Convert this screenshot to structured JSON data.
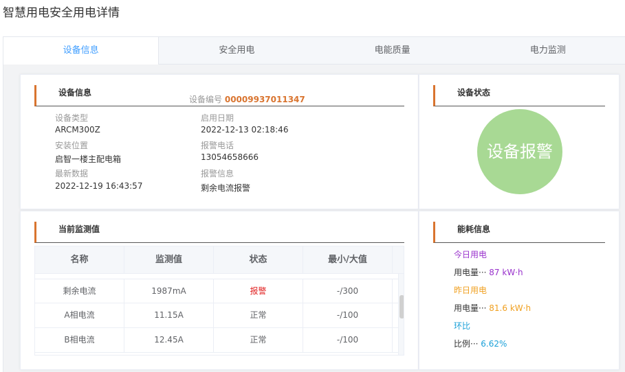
{
  "page_title": "智慧用电安全用电详情",
  "tabs": [
    {
      "label": "设备信息",
      "active": true
    },
    {
      "label": "安全用电",
      "active": false
    },
    {
      "label": "电能质量",
      "active": false
    },
    {
      "label": "电力监测",
      "active": false
    }
  ],
  "device_info": {
    "title": "设备信息",
    "device_no_label": "设备编号",
    "device_no": "00009937011347",
    "fields": {
      "type_label": "设备类型",
      "type_value": "ARCM300Z",
      "location_label": "安装位置",
      "location_value": "启智一楼主配电箱",
      "latest_label": "最新数据",
      "latest_value": "2022-12-19 16:43:57",
      "enable_label": "启用日期",
      "enable_value": "2022-12-13 02:18:46",
      "phone_label": "报警电话",
      "phone_value": "13054658666",
      "alarm_label": "报警信息",
      "alarm_value": "剩余电流报警"
    }
  },
  "device_status": {
    "title": "设备状态",
    "status": "设备报警",
    "color": "#a8d994"
  },
  "monitor": {
    "title": "当前监测值",
    "columns": [
      "名称",
      "监测值",
      "状态",
      "最小/大值"
    ],
    "rows": [
      {
        "name": "剩余电流",
        "value": "1987mA",
        "status": "报警",
        "range": "-/300"
      },
      {
        "name": "A相电流",
        "value": "11.15A",
        "status": "正常",
        "range": "-/100"
      },
      {
        "name": "B相电流",
        "value": "12.45A",
        "status": "正常",
        "range": "-/100"
      }
    ],
    "alarm_color": "#e02020"
  },
  "energy": {
    "title": "能耗信息",
    "today_label": "今日用电",
    "today_text": "用电量···",
    "today_value": "87 kW·h",
    "yesterday_label": "昨日用电",
    "yesterday_text": "用电量···",
    "yesterday_value": "81.6 kW·h",
    "ratio_label": "环比",
    "ratio_text": "比例···",
    "ratio_value": "6.62%"
  },
  "colors": {
    "accent": "#409eff",
    "heading_bar": "#d9742f",
    "purple": "#9932cc",
    "orange": "#f0a020",
    "blue": "#1aa0d8"
  }
}
